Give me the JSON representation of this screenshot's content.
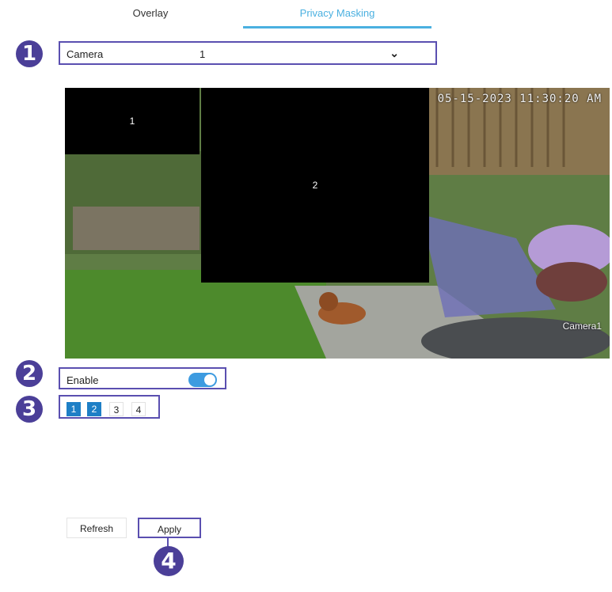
{
  "tabs": [
    {
      "label": "Overlay"
    },
    {
      "label": "Privacy Masking",
      "active": true
    }
  ],
  "camera": {
    "label": "Camera",
    "value": "1"
  },
  "video": {
    "timestamp": "05-15-2023 11:30:20 AM",
    "camera_label": "Camera1",
    "masks": [
      {
        "label": "1"
      },
      {
        "label": "2"
      }
    ]
  },
  "enable": {
    "label": "Enable",
    "on": true
  },
  "areas": [
    {
      "label": "1",
      "selected": true
    },
    {
      "label": "2",
      "selected": true
    },
    {
      "label": "3",
      "selected": false
    },
    {
      "label": "4",
      "selected": false
    }
  ],
  "buttons": {
    "refresh": "Refresh",
    "apply": "Apply"
  },
  "callouts": [
    "1",
    "2",
    "3",
    "4"
  ],
  "colors": {
    "accent": "#4ab0e0",
    "callout": "#4b3f98",
    "area_selected": "#1e7fc6",
    "toggle_on": "#3d9be0"
  }
}
